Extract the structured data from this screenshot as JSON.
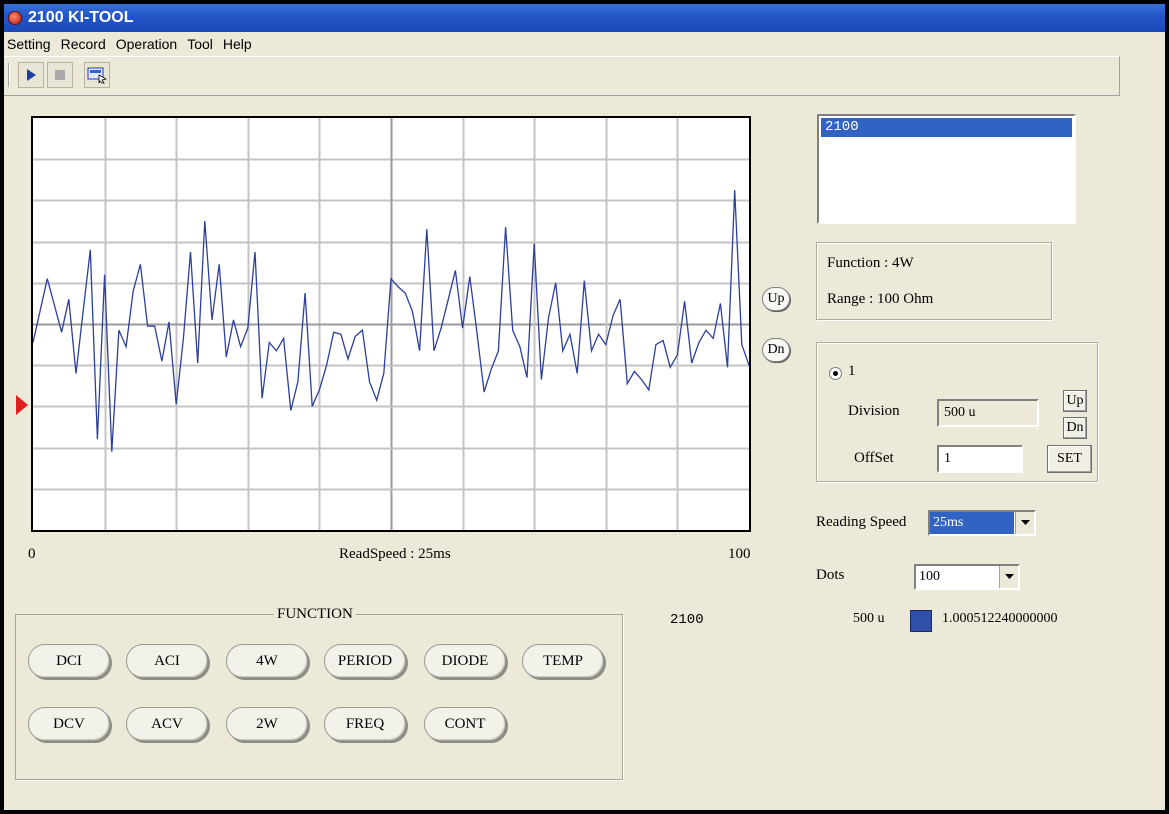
{
  "window": {
    "title": "2100 KI-TOOL"
  },
  "menu": [
    "Setting",
    "Record",
    "Operation",
    "Tool",
    "Help"
  ],
  "toolbar": {
    "run_icon": "play-icon",
    "stop_icon": "stop-icon",
    "config_icon": "screen-settings-icon"
  },
  "graph": {
    "x_min_label": "0",
    "x_max_label": "100",
    "speed_label": "ReadSpeed : 25ms",
    "up_label": "Up",
    "down_label": "Dn"
  },
  "chart_data": {
    "type": "line",
    "xlim": [
      0,
      100
    ],
    "grid": true,
    "series": [
      {
        "color": "#2c3f9a",
        "x": [
          0,
          2,
          3,
          4,
          5,
          6,
          7,
          8,
          9,
          10,
          11,
          12,
          13,
          14,
          15,
          16,
          17,
          18,
          19,
          20,
          21,
          22,
          23,
          24,
          25,
          26,
          27,
          28,
          29,
          30,
          31,
          32,
          33,
          34,
          35,
          36,
          37,
          38,
          39,
          40,
          41,
          42,
          43,
          44,
          45,
          46,
          47,
          48,
          49,
          50,
          51,
          52,
          53,
          54,
          55,
          56,
          57,
          58,
          59,
          60,
          61,
          62,
          63,
          64,
          65,
          66,
          67,
          68,
          69,
          70,
          71,
          72,
          73,
          74,
          75,
          76,
          77,
          78,
          79,
          80,
          81,
          82,
          83,
          84,
          85,
          86,
          87,
          88,
          89,
          90,
          91,
          92,
          93,
          94,
          95,
          96,
          97,
          98,
          99,
          100
        ],
        "y": [
          -0.9,
          2.2,
          0.9,
          -0.4,
          1.2,
          -2.4,
          0.6,
          3.6,
          -5.6,
          2.4,
          -6.2,
          -0.3,
          -1.1,
          1.6,
          2.9,
          -0.1,
          -0.1,
          -1.8,
          0.1,
          -3.9,
          -0.7,
          3.5,
          -1.9,
          5.0,
          0.2,
          2.9,
          -1.6,
          0.2,
          -1.1,
          -0.2,
          3.5,
          -3.6,
          -0.9,
          -1.3,
          -0.7,
          -4.2,
          -2.8,
          1.5,
          -4.0,
          -3.2,
          -2.0,
          -0.4,
          -0.5,
          -1.7,
          -0.6,
          -0.3,
          -2.8,
          -3.7,
          -2.4,
          2.2,
          1.8,
          1.5,
          0.6,
          -1.3,
          4.6,
          -1.3,
          -0.2,
          1.2,
          2.6,
          -0.2,
          2.3,
          -0.4,
          -3.3,
          -2.2,
          -1.3,
          4.7,
          -0.3,
          -1.1,
          -2.6,
          3.9,
          -2.7,
          0.3,
          2.0,
          -1.3,
          -0.5,
          -2.4,
          2.1,
          -1.3,
          -0.5,
          -1.0,
          0.4,
          1.2,
          -2.9,
          -2.3,
          -2.7,
          -3.2,
          -1.0,
          -0.8,
          -2.1,
          -1.5,
          1.1,
          -1.9,
          -0.9,
          -0.3,
          -0.7,
          1.0,
          -2.1,
          6.5,
          -1.0,
          -2.0
        ],
        "ylim": [
          -10,
          10
        ]
      }
    ]
  },
  "meter_list": {
    "selected": "2100"
  },
  "status": {
    "function": "Function : 4W",
    "range": "Range : 100  Ohm"
  },
  "channel": {
    "radio_label": "1",
    "division_label": "Division",
    "division_value": "500 u",
    "offset_label": "OffSet",
    "offset_value": "1",
    "up_label": "Up",
    "down_label": "Dn",
    "set_label": "SET"
  },
  "reading_speed": {
    "label": "Reading Speed",
    "value": "25ms"
  },
  "dots": {
    "label": "Dots",
    "value": "100"
  },
  "readout": {
    "device": "2100",
    "division": "500 u",
    "value": "1.000512240000000",
    "swatch_color": "#2f4fa8"
  },
  "function_panel": {
    "title": "FUNCTION",
    "row1": [
      "DCI",
      "ACI",
      "4W",
      "PERIOD",
      "DIODE",
      "TEMP"
    ],
    "row2": [
      "DCV",
      "ACV",
      "2W",
      "FREQ",
      "CONT"
    ]
  }
}
